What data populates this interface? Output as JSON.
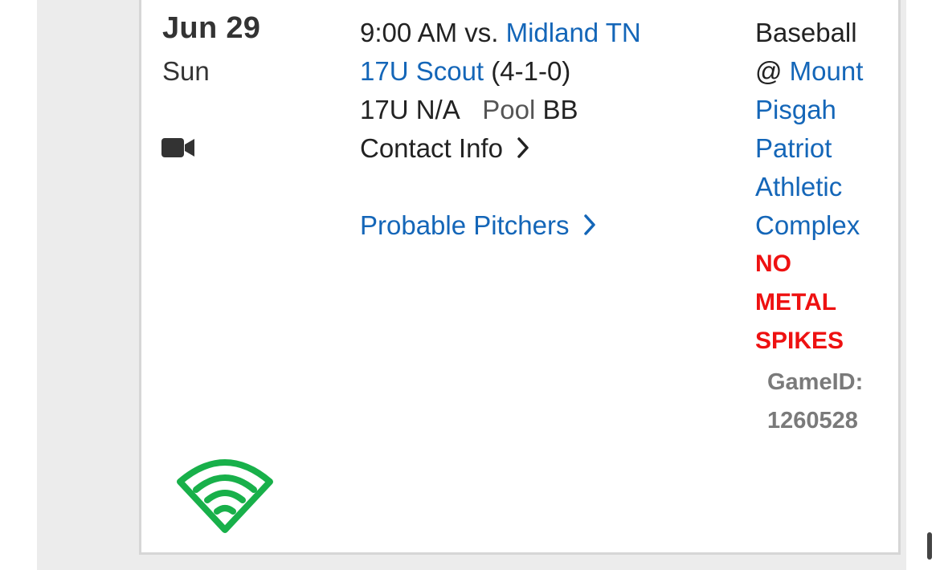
{
  "game": {
    "date": "Jun 29",
    "day": "Sun",
    "time_vs": "9:00 AM vs.",
    "opponent": "Midland TN",
    "team": "17U Scout",
    "record": "(4-1-0)",
    "division": "17U N/A",
    "pool_label": "Pool",
    "pool_value": "BB",
    "contact_info": "Contact Info",
    "probable_pitchers": "Probable Pitchers",
    "sport": "Baseball",
    "at_symbol": "@",
    "venue_lines": [
      "Mount",
      "Pisgah",
      "Patriot",
      "Athletic",
      "Complex"
    ],
    "alert_lines": [
      "NO",
      "METAL",
      "SPIKES"
    ],
    "gameid_label": "GameID:",
    "gameid_value": "1260528"
  },
  "icons": {
    "video": "video-camera-icon",
    "logo": "gamechanger-diamond-logo",
    "chevron": "chevron-right-icon"
  },
  "colors": {
    "link": "#1466b8",
    "alert": "#ee1111",
    "logo_green": "#18b04a",
    "gameid_gray": "#7a7a7a"
  }
}
